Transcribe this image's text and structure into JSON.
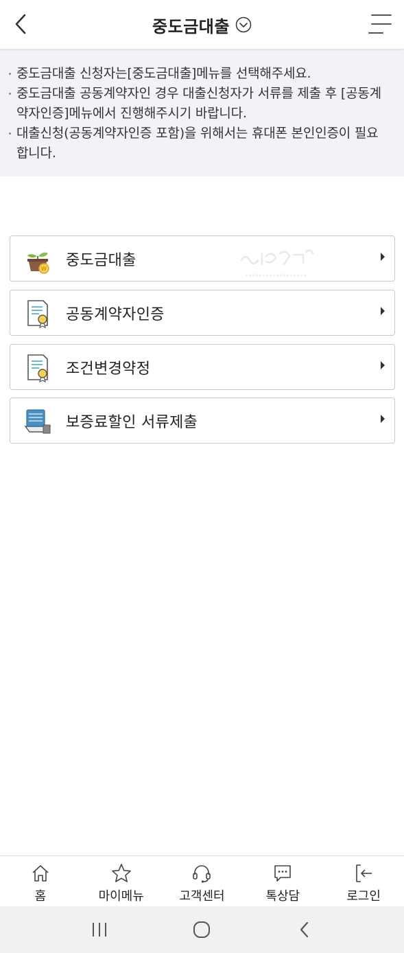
{
  "header": {
    "title": "중도금대출",
    "back_icon": "chevron-left-icon",
    "dropdown_icon": "chevron-down-circle-icon",
    "menu_icon": "hamburger-icon"
  },
  "notice": {
    "items": [
      "중도금대출 신청자는[중도금대출]메뉴를 선택해주세요.",
      "중도금대출 공동계약자인 경우 대출신청자가 서류를 제출 후 [공동계약자인증]메뉴에서 진행해주시기 바랍니다.",
      "대출신청(공동계약자인증 포함)을 위해서는 휴대폰 본인인증이 필요합니다."
    ]
  },
  "menu": {
    "items": [
      {
        "label": "중도금대출",
        "icon": "plant-pot-coin-icon"
      },
      {
        "label": "공동계약자인증",
        "icon": "certificate-icon"
      },
      {
        "label": "조건변경약정",
        "icon": "certificate-icon"
      },
      {
        "label": "보증료할인 서류제출",
        "icon": "document-stack-icon"
      }
    ]
  },
  "bottom_nav": {
    "items": [
      {
        "label": "홈",
        "icon": "home-icon"
      },
      {
        "label": "마이메뉴",
        "icon": "star-icon"
      },
      {
        "label": "고객센터",
        "icon": "headset-icon"
      },
      {
        "label": "톡상담",
        "icon": "chat-bubble-icon"
      },
      {
        "label": "로그인",
        "icon": "login-icon"
      }
    ]
  },
  "system_nav": {
    "items": [
      "recent-apps-icon",
      "home-circle-icon",
      "back-icon"
    ]
  },
  "colors": {
    "notice_bg": "#f2f3f7",
    "card_border": "#c9c9c9",
    "text": "#222222",
    "sys_nav_bg": "#f1f1f1"
  }
}
